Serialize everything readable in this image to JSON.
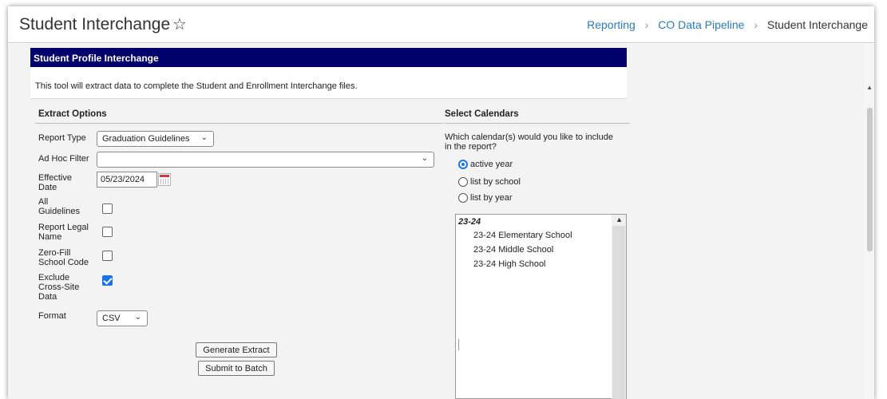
{
  "header": {
    "title": "Student Interchange",
    "star_icon": "star-outline-icon",
    "breadcrumb": [
      "Reporting",
      "CO Data Pipeline",
      "Student Interchange"
    ]
  },
  "panel": {
    "title": "Student Profile Interchange",
    "description": "This tool will extract data to complete the Student and Enrollment Interchange files."
  },
  "extract_options": {
    "title": "Extract Options",
    "report_type_label": "Report Type",
    "report_type_value": "Graduation Guidelines",
    "ad_hoc_filter_label": "Ad Hoc Filter",
    "ad_hoc_filter_value": "",
    "effective_date_label": [
      "Effective",
      "Date"
    ],
    "effective_date_value": "05/23/2024",
    "all_guidelines_label": [
      "All",
      "Guidelines"
    ],
    "all_guidelines_checked": false,
    "report_legal_name_label": [
      "Report Legal",
      "Name"
    ],
    "report_legal_name_checked": false,
    "zero_fill_label": [
      "Zero-Fill",
      "School Code"
    ],
    "zero_fill_checked": false,
    "exclude_cross_site_label": [
      "Exclude",
      "Cross-Site",
      "Data"
    ],
    "exclude_cross_site_checked": true,
    "format_label": "Format",
    "format_value": "CSV",
    "generate_button": "Generate Extract",
    "batch_button": "Submit to Batch"
  },
  "calendars": {
    "title": "Select Calendars",
    "prompt": [
      "Which calendar(s) would you like to include",
      "in the report?"
    ],
    "options": [
      "active year",
      "list by school",
      "list by year"
    ],
    "selected": "active year",
    "list_group": "23-24",
    "list_items": [
      "23-24 Elementary School",
      "23-24 Middle School",
      "23-24 High School"
    ]
  },
  "colors": {
    "header_bar": "#02006a",
    "link": "#2a7ab9",
    "check_accent": "#1a73e8"
  }
}
